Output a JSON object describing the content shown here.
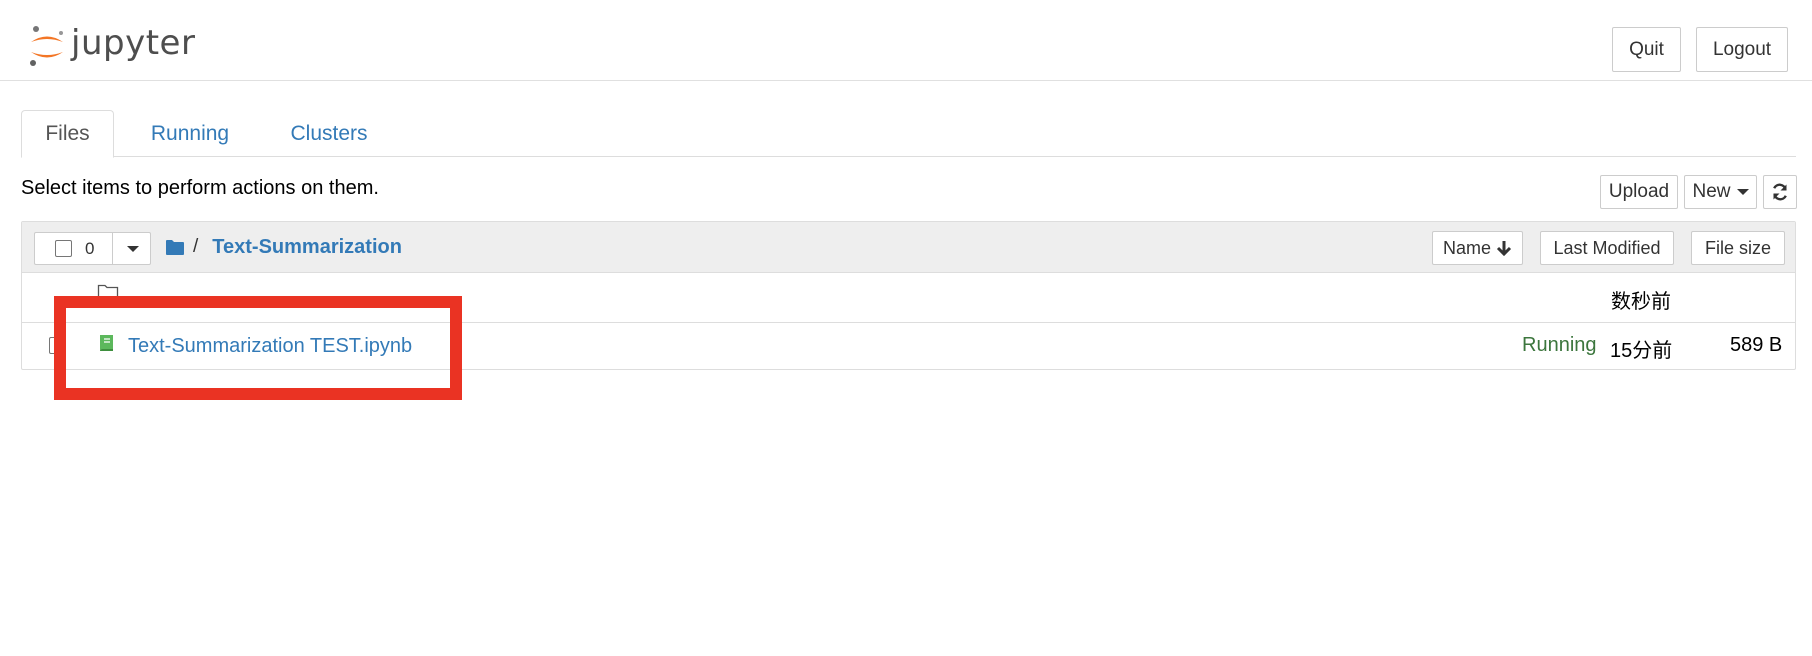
{
  "header": {
    "logo_text": "jupyter",
    "quit_label": "Quit",
    "logout_label": "Logout"
  },
  "tabs": [
    {
      "label": "Files",
      "active": true
    },
    {
      "label": "Running",
      "active": false
    },
    {
      "label": "Clusters",
      "active": false
    }
  ],
  "hint_text": "Select items to perform actions on them.",
  "toolbar": {
    "upload_label": "Upload",
    "new_label": "New"
  },
  "list_header": {
    "selected_count": "0",
    "breadcrumb_sep": "/",
    "current_folder": "Text-Summarization",
    "sort_name_label": "Name",
    "sort_modified_label": "Last Modified",
    "sort_size_label": "File size"
  },
  "rows": [
    {
      "name": "",
      "modified": "数秒前",
      "size": "",
      "status": ""
    },
    {
      "name": "Text-Summarization TEST.ipynb",
      "modified": "15分前",
      "size": "589 B",
      "status": "Running"
    }
  ],
  "colors": {
    "link": "#337ab7",
    "running": "#3c763d",
    "highlight": "#ea3323",
    "logo_orange": "#f37626"
  }
}
